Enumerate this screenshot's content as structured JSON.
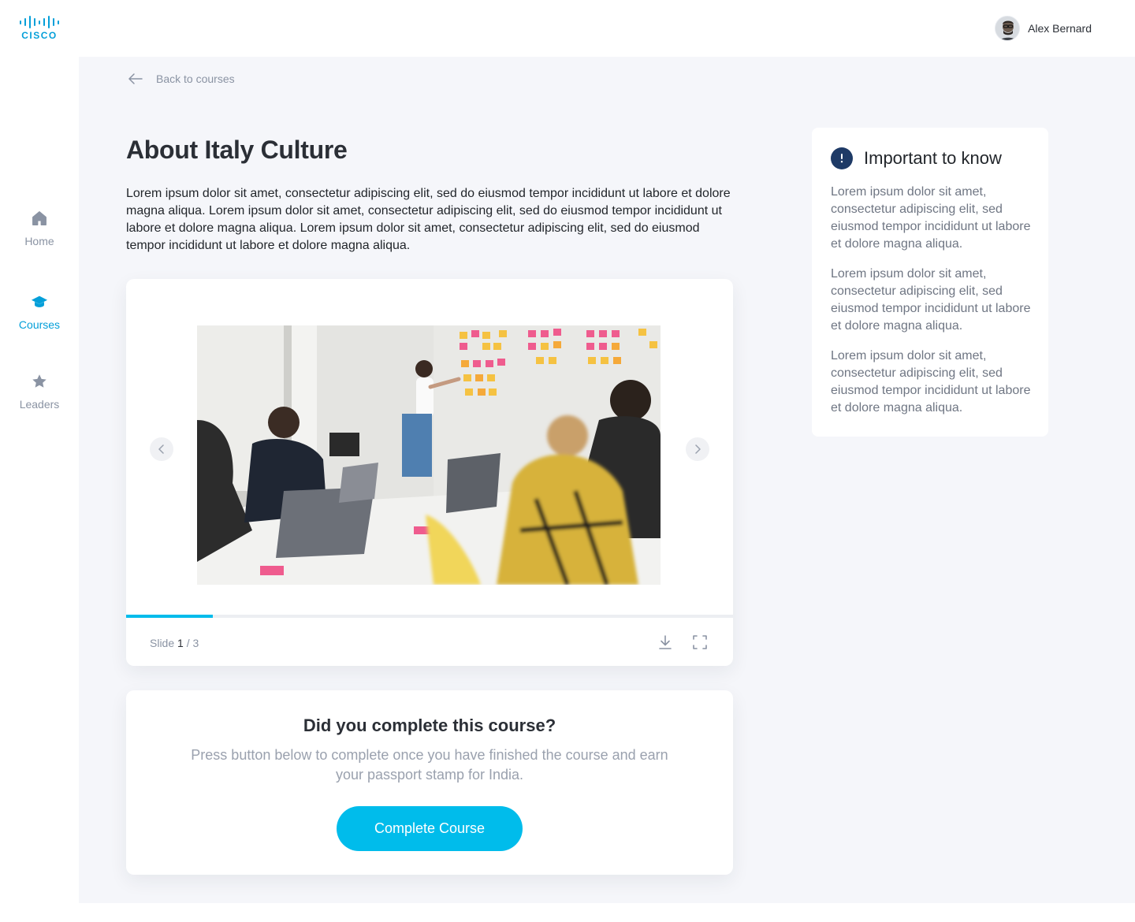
{
  "brand": {
    "logo_text": "CISCO",
    "accent": "#00bceb",
    "brand_blue": "#049fd9"
  },
  "sidebar": {
    "items": [
      {
        "label": "Home",
        "icon": "home-icon",
        "active": false
      },
      {
        "label": "Courses",
        "icon": "graduation-cap-icon",
        "active": true
      },
      {
        "label": "Leaders",
        "icon": "star-icon",
        "active": false
      }
    ]
  },
  "header": {
    "user_name": "Alex Bernard"
  },
  "main": {
    "back_label": "Back to courses",
    "title": "About Italy Culture",
    "intro": "Lorem ipsum dolor sit amet, consectetur adipiscing elit, sed do eiusmod tempor incididunt ut labore et dolore magna aliqua. Lorem ipsum dolor sit amet, consectetur adipiscing elit, sed do eiusmod tempor incididunt ut labore et dolore magna aliqua. Lorem ipsum dolor sit amet, consectetur adipiscing elit, sed do eiusmod tempor incididunt ut labore et dolore magna aliqua."
  },
  "slides": {
    "prefix": "Slide",
    "current": "1",
    "separator": "/",
    "total": "3",
    "progress_fraction": 0.1429
  },
  "completion": {
    "title": "Did you complete this course?",
    "subtitle": "Press button below to complete once you have finished the course and earn your passport stamp for India.",
    "button_label": "Complete Course"
  },
  "info": {
    "title": "Important to know",
    "paragraphs": [
      "Lorem ipsum dolor sit amet, consectetur adipiscing elit, sed eiusmod tempor incididunt ut labore et dolore magna aliqua.",
      "Lorem ipsum dolor sit amet, consectetur adipiscing elit, sed eiusmod tempor incididunt ut labore et dolore magna aliqua.",
      "Lorem ipsum dolor sit amet, consectetur adipiscing elit, sed eiusmod tempor incididunt ut labore et dolore magna aliqua."
    ]
  }
}
